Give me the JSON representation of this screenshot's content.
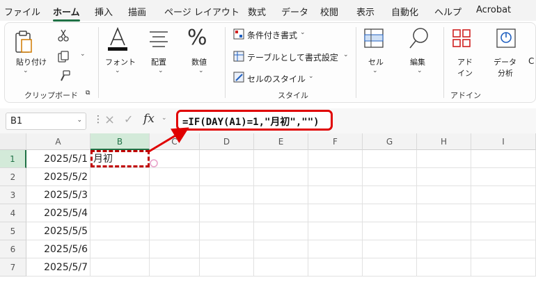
{
  "menu": {
    "tabs": [
      "ファイル",
      "ホーム",
      "挿入",
      "描画",
      "ページ レイアウト",
      "数式",
      "データ",
      "校閲",
      "表示",
      "自動化",
      "ヘルプ",
      "Acrobat"
    ],
    "active": "ホーム"
  },
  "ribbon": {
    "paste": "貼り付け",
    "font": "フォント",
    "align": "配置",
    "number": "数値",
    "conditional_format": "条件付き書式",
    "format_table": "テーブルとして書式設定",
    "cell_styles": "セルのスタイル",
    "cells": "セル",
    "editing": "編集",
    "addin_line1": "アド",
    "addin_line2": "イン",
    "data_line1": "データ",
    "data_line2": "分析",
    "groups": {
      "clipboard": "クリップボード",
      "style": "スタイル",
      "addins": "アドイン"
    }
  },
  "formula_bar": {
    "name_box": "B1",
    "cancel_icon": "×",
    "enter_icon": "✓",
    "fx": "fx",
    "formula": "=IF(DAY(A1)=1,\"月初\",\"\")"
  },
  "grid": {
    "columns": [
      "A",
      "B",
      "C",
      "D",
      "E",
      "F",
      "G",
      "H",
      "I"
    ],
    "selected_column": "B",
    "rows": [
      {
        "num": "1",
        "a": "2025/5/1",
        "b": "月初"
      },
      {
        "num": "2",
        "a": "2025/5/2",
        "b": ""
      },
      {
        "num": "3",
        "a": "2025/5/3",
        "b": ""
      },
      {
        "num": "4",
        "a": "2025/5/4",
        "b": ""
      },
      {
        "num": "5",
        "a": "2025/5/5",
        "b": ""
      },
      {
        "num": "6",
        "a": "2025/5/6",
        "b": ""
      },
      {
        "num": "7",
        "a": "2025/5/7",
        "b": ""
      }
    ]
  },
  "colors": {
    "accent": "#1f7145",
    "highlight": "#e00000"
  }
}
